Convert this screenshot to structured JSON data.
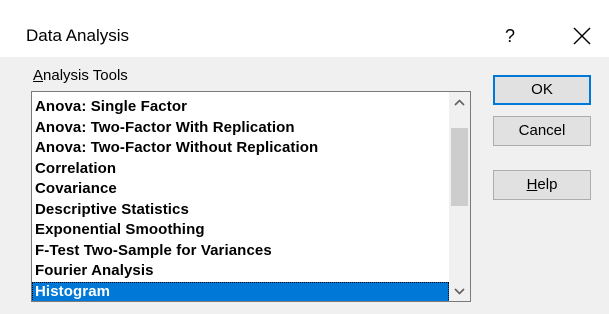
{
  "window": {
    "title": "Data Analysis",
    "help_glyph": "?",
    "close_icon": "close-icon"
  },
  "tools": {
    "label_accel": "A",
    "label_rest": "nalysis Tools",
    "items": [
      "Anova: Single Factor",
      "Anova: Two-Factor With Replication",
      "Anova: Two-Factor Without Replication",
      "Correlation",
      "Covariance",
      "Descriptive Statistics",
      "Exponential Smoothing",
      "F-Test Two-Sample for Variances",
      "Fourier Analysis",
      "Histogram"
    ],
    "selected": "Histogram"
  },
  "buttons": {
    "ok": "OK",
    "cancel": "Cancel",
    "help_accel": "H",
    "help_rest": "elp"
  },
  "colors": {
    "selection": "#0078d7",
    "default_button_border": "#0078d7",
    "dialog_background": "#f0f0f0"
  }
}
